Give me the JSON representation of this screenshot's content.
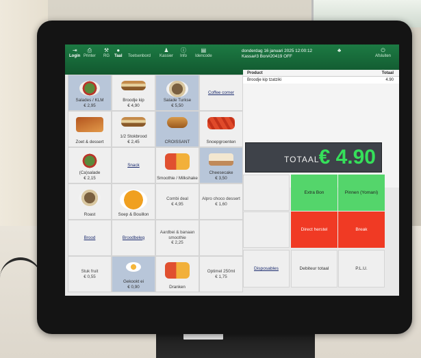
{
  "topbar": {
    "items": [
      {
        "label": "Login",
        "icon": "login-icon",
        "glyph": "⇥"
      },
      {
        "label": "Printer",
        "icon": "printer-icon",
        "glyph": "⎙"
      },
      {
        "label": "RG",
        "icon": "tools-icon",
        "glyph": "⚒"
      },
      {
        "label": "Taal",
        "icon": "globe-icon",
        "glyph": "●"
      },
      {
        "label": "Toetsenbord",
        "icon": "keyboard-icon",
        "glyph": ""
      },
      {
        "label": "Kassier",
        "icon": "user-icon",
        "glyph": "♟"
      },
      {
        "label": "Info",
        "icon": "info-icon",
        "glyph": "ⓘ"
      },
      {
        "label": "Idencode",
        "icon": "id-card-icon",
        "glyph": "▤"
      }
    ],
    "date_line1": "donderdag 16 januari 2025 12:00:12",
    "date_line2": "Kassa#3 Bon#20419 OFF",
    "afsluiten_label": "Afsluiten",
    "afsluiten_icon": "power-icon"
  },
  "tiles": [
    {
      "l1": "Salades / KLM",
      "l2": "€ 2,95",
      "img": "salad",
      "bg": "blue"
    },
    {
      "l1": "Broodje kip",
      "l2": "€ 4,90",
      "img": "sandwich",
      "bg": ""
    },
    {
      "l1": "Salade Turkse",
      "l2": "€ 5,50",
      "img": "bowl",
      "bg": "blue"
    },
    {
      "l1": "Coffee corner",
      "l2": "",
      "img": "",
      "bg": "",
      "style": "link"
    },
    {
      "l1": "Zoet & dessert",
      "l2": "",
      "img": "pie",
      "bg": ""
    },
    {
      "l1": "1/2 Stokbrood",
      "l2": "€ 2,45",
      "img": "sandwich",
      "bg": ""
    },
    {
      "l1": "CROISSANT",
      "l2": "",
      "img": "croissant",
      "bg": "blue"
    },
    {
      "l1": "Snoepgroenten",
      "l2": "",
      "img": "veg",
      "bg": ""
    },
    {
      "l1": "(Ca)salade",
      "l2": "€ 2,15",
      "img": "salad",
      "bg": ""
    },
    {
      "l1": "Snack",
      "l2": "",
      "img": "",
      "bg": "",
      "style": "link"
    },
    {
      "l1": "Smoothie / Milkshake",
      "l2": "",
      "img": "drinks",
      "bg": ""
    },
    {
      "l1": "Cheesecake",
      "l2": "€ 3,50",
      "img": "cake",
      "bg": "blue"
    },
    {
      "l1": "Roast",
      "l2": "",
      "img": "bowl",
      "bg": ""
    },
    {
      "l1": "Soep & Bouillon",
      "l2": "",
      "img": "soup",
      "bg": ""
    },
    {
      "l1": "Combi deal",
      "l2": "€ 4,95",
      "img": "",
      "bg": "",
      "style": "plain"
    },
    {
      "l1": "Alpro choco dessert",
      "l2": "€ 1,60",
      "img": "",
      "bg": "",
      "style": "plain"
    },
    {
      "l1": "Brood",
      "l2": "",
      "img": "",
      "bg": "",
      "style": "link"
    },
    {
      "l1": "Broodbeleg",
      "l2": "",
      "img": "",
      "bg": "",
      "style": "link"
    },
    {
      "l1": "Aardbei & banaan smoothie",
      "l2": "€ 2,25",
      "img": "",
      "bg": "",
      "style": "plain"
    },
    {
      "l1": "",
      "l2": "",
      "img": "",
      "bg": "",
      "style": "plain"
    },
    {
      "l1": "Stuk fruit",
      "l2": "€ 0,55",
      "img": "",
      "bg": "",
      "style": "plain"
    },
    {
      "l1": "Gekookt ei",
      "l2": "€ 0,90",
      "img": "egg",
      "bg": "blue"
    },
    {
      "l1": "Dranken",
      "l2": "",
      "img": "drinks",
      "bg": ""
    },
    {
      "l1": "Optimel 250ml",
      "l2": "€ 1,75",
      "img": "",
      "bg": "",
      "style": "plain"
    }
  ],
  "order": {
    "header_product": "Product",
    "header_total": "Totaal",
    "lines": [
      {
        "name": "Broodje kip tzatziki",
        "amount": "4.90"
      }
    ],
    "total_label": "TOTAAL",
    "total_value": "€ 4.90"
  },
  "actions": {
    "extra_bon": "Extra Bon",
    "pinnen": "Pinnen (Yomani)",
    "direct_herstel": "Direct herstel",
    "break": "Break",
    "disposables": "Disposables",
    "debiteur_totaal": "Debiteur totaal",
    "plu": "P.L.U."
  },
  "colors": {
    "topbar_green": "#12582f",
    "total_green": "#35e05a",
    "action_green": "#54d56b",
    "action_red": "#f03a24"
  }
}
